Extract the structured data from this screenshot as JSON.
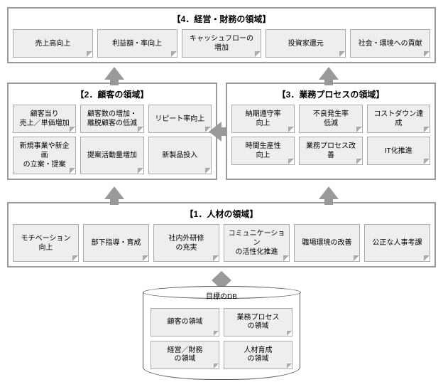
{
  "domain4": {
    "title": "【4．経営・財務の領域】",
    "items": [
      "売上高向上",
      "利益額・率向上",
      "キャッシュフローの\n増加",
      "投資家還元",
      "社会・環境への貢献"
    ]
  },
  "domain2": {
    "title": "【2．顧客の領域】",
    "row1": [
      "顧客当り\n売上／単価増加",
      "顧客数の増加・\n離脱顧客の低減",
      "リピート率向上"
    ],
    "row2": [
      "新規事業や新企画\nの立案・提案",
      "提案活動量増加",
      "新製品投入"
    ]
  },
  "domain3": {
    "title": "【3．業務プロセスの領域】",
    "row1": [
      "納期遵守率\n向上",
      "不良発生率\n低減",
      "コストダウン達成"
    ],
    "row2": [
      "時間生産性\n向上",
      "業務プロセス改善",
      "IT化推進"
    ]
  },
  "domain1": {
    "title": "【1．人材の領域】",
    "items": [
      "モチベーション\n向上",
      "部下指導・育成",
      "社内外研修\nの充実",
      "コミュニケーション\nの活性化推進",
      "職場環境の改善",
      "公正な人事考課"
    ]
  },
  "db": {
    "title": "目標のDB",
    "items": [
      "顧客の領域",
      "業務プロセス\nの領域",
      "経営／財務\nの領域",
      "人材育成\nの領域"
    ]
  }
}
